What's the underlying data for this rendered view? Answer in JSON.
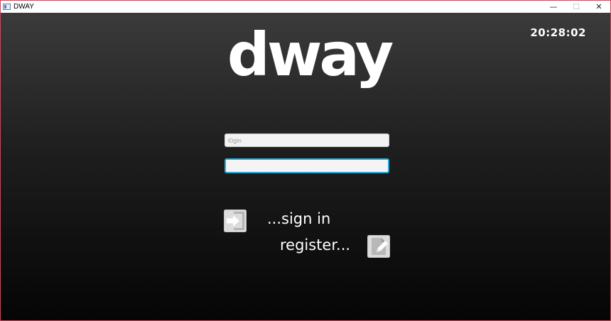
{
  "window": {
    "title": "DWAY",
    "minimize_symbol": "—",
    "maximize_symbol": "☐",
    "close_symbol": "✕",
    "border_color": "#c8485a"
  },
  "header": {
    "logo_text": "dway",
    "clock": "20:28:02"
  },
  "form": {
    "login_placeholder": "l0gin",
    "login_value": "",
    "password_value": "",
    "focus_color": "#2aa9d6"
  },
  "actions": {
    "sign_in_label": "...sign in",
    "sign_in_icon": "enter-arrow-icon",
    "register_label": "register...",
    "register_icon": "edit-document-icon"
  }
}
